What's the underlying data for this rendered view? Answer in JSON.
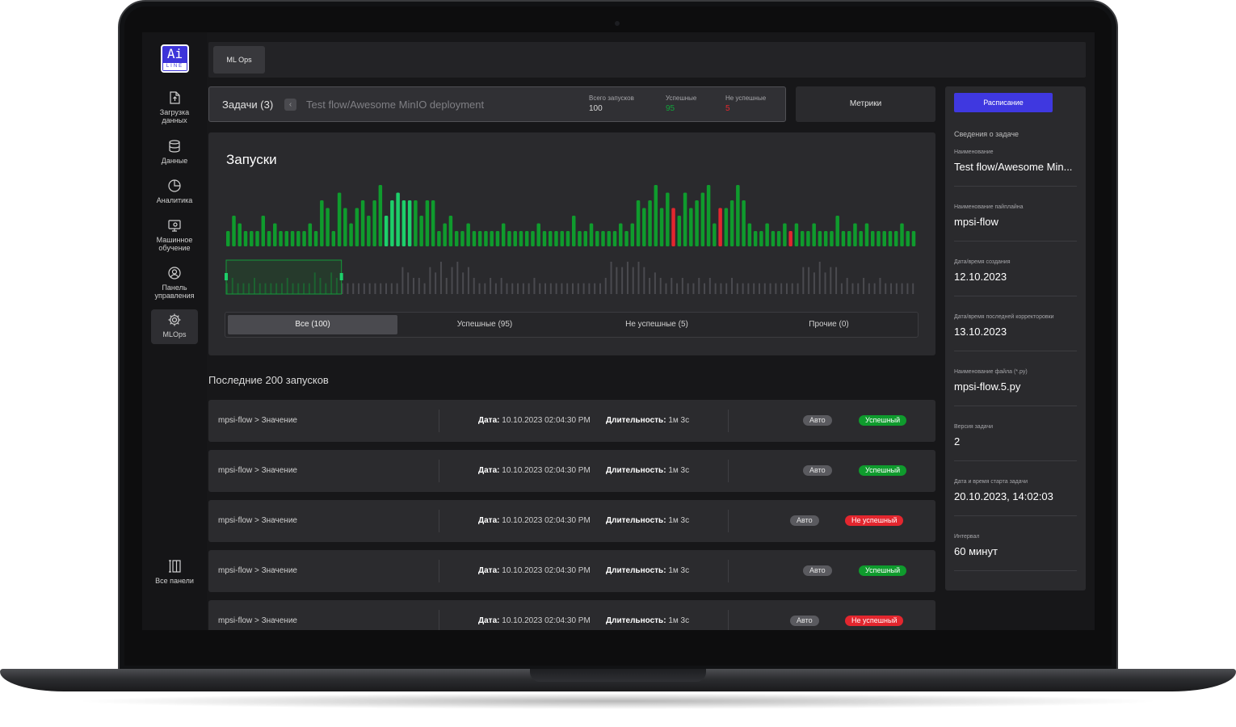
{
  "app": {
    "logo_text": "Ai",
    "logo_sub": "LINE"
  },
  "sidebar": {
    "items": [
      {
        "label": "Загрузка данных",
        "icon": "file-upload-icon"
      },
      {
        "label": "Данные",
        "icon": "database-icon"
      },
      {
        "label": "Аналитика",
        "icon": "pie-chart-icon"
      },
      {
        "label": "Машинное обучение",
        "icon": "monitor-gear-icon"
      },
      {
        "label": "Панель управления",
        "icon": "user-badge-icon"
      },
      {
        "label": "MLOps",
        "icon": "gear-icon",
        "active": true
      }
    ],
    "all_panels": {
      "label": "Все панели",
      "icon": "panels-icon"
    }
  },
  "topbar": {
    "tab_label": "ML Ops"
  },
  "task": {
    "title": "Задачи (3)",
    "back_icon": "chevron-left-icon",
    "path": "Test flow/Awesome MinIO deployment",
    "stats": [
      {
        "label": "Всего запусков",
        "value": "100",
        "color": "#d8d8d8"
      },
      {
        "label": "Успешные",
        "value": "95",
        "color": "#12a33a"
      },
      {
        "label": "Не успешные",
        "value": "5",
        "color": "#e3262e"
      }
    ]
  },
  "metrics_button": "Метрики",
  "runs_chart": {
    "title": "Запуски",
    "filters": [
      "Все (100)",
      "Успешные (95)",
      "Не успешные (5)",
      "Прочие (0)"
    ],
    "active_filter": 0
  },
  "chart_data": {
    "type": "bar",
    "title": "Запуски",
    "colors": {
      "success": "#0f9b2d",
      "success_highlight": "#1dcf6a",
      "fail": "#e3262e",
      "overview": "#4a4a4f"
    },
    "highlighted_range": [
      27,
      31
    ],
    "values": [
      2,
      4,
      3,
      2,
      2,
      2,
      4,
      2,
      3,
      2,
      2,
      2,
      2,
      2,
      3,
      2,
      6,
      5,
      2,
      7,
      5,
      3,
      5,
      6,
      4,
      6,
      8,
      4,
      6,
      7,
      6,
      6,
      6,
      4,
      6,
      6,
      2,
      3,
      4,
      2,
      2,
      3,
      2,
      2,
      2,
      2,
      2,
      3,
      2,
      2,
      2,
      2,
      2,
      3,
      2,
      2,
      2,
      2,
      2,
      4,
      2,
      2,
      3,
      2,
      2,
      2,
      2,
      3,
      2,
      3,
      6,
      5,
      6,
      8,
      5,
      7,
      5,
      4,
      7,
      5,
      6,
      7,
      8,
      3,
      5,
      5,
      6,
      8,
      6,
      3,
      2,
      2,
      3,
      2,
      2,
      3,
      2,
      3,
      2,
      2,
      3,
      2,
      2,
      2,
      4,
      2,
      2,
      3,
      2,
      3,
      2,
      2,
      2,
      2,
      2,
      3,
      2,
      2
    ],
    "fail_indices": [
      76,
      84,
      96
    ],
    "ylim": [
      0,
      8
    ],
    "overview_values": [
      2,
      3,
      2,
      2,
      2,
      3,
      2,
      2,
      2,
      2,
      2,
      3,
      2,
      2,
      2,
      2,
      4,
      3,
      2,
      4,
      3,
      2,
      2,
      2,
      2,
      2,
      2,
      2,
      2,
      2,
      2,
      2,
      5,
      4,
      3,
      3,
      2,
      5,
      4,
      6,
      3,
      5,
      6,
      4,
      5,
      3,
      2,
      2,
      3,
      2,
      3,
      2,
      2,
      2,
      2,
      2,
      3,
      2,
      2,
      2,
      2,
      2,
      2,
      2,
      2,
      2,
      2,
      2,
      2,
      3,
      6,
      5,
      5,
      6,
      5,
      6,
      5,
      3,
      4,
      3,
      2,
      3,
      2,
      3,
      2,
      2,
      3,
      2,
      3,
      2,
      2,
      2,
      3,
      2,
      2,
      2,
      2,
      2,
      2,
      2,
      2,
      2,
      2,
      2,
      2,
      5,
      5,
      4,
      6,
      4,
      5,
      5,
      2,
      3,
      2,
      2,
      3,
      2,
      2,
      3,
      2,
      2,
      2,
      2,
      2,
      2
    ],
    "overview_selection": [
      0,
      20
    ]
  },
  "runs_list": {
    "title": "Последние 200 запусков",
    "date_label": "Дата:",
    "duration_label": "Длительность:",
    "rows": [
      {
        "name": "mpsi-flow > Значение",
        "date": "10.10.2023 02:04:30 PM",
        "duration": "1м 3с",
        "mode": "Авто",
        "status": "Успешный",
        "ok": true
      },
      {
        "name": "mpsi-flow > Значение",
        "date": "10.10.2023 02:04:30 PM",
        "duration": "1м 3с",
        "mode": "Авто",
        "status": "Успешный",
        "ok": true
      },
      {
        "name": "mpsi-flow > Значение",
        "date": "10.10.2023 02:04:30 PM",
        "duration": "1м 3с",
        "mode": "Авто",
        "status": "Не успешный",
        "ok": false
      },
      {
        "name": "mpsi-flow > Значение",
        "date": "10.10.2023 02:04:30 PM",
        "duration": "1м 3с",
        "mode": "Авто",
        "status": "Успешный",
        "ok": true
      },
      {
        "name": "mpsi-flow > Значение",
        "date": "10.10.2023 02:04:30 PM",
        "duration": "1м 3с",
        "mode": "Авто",
        "status": "Не успешный",
        "ok": false
      }
    ]
  },
  "right_panel": {
    "schedule_button": "Расписание",
    "heading": "Сведения о задаче",
    "fields": [
      {
        "label": "Наименование",
        "value": "Test flow/Awesome Min..."
      },
      {
        "label": "Наименование пайплайна",
        "value": "mpsi-flow"
      },
      {
        "label": "Дата/время создания",
        "value": "12.10.2023"
      },
      {
        "label": "Дата/время последней корректоровки",
        "value": "13.10.2023"
      },
      {
        "label": "Наименование файла (*.py)",
        "value": "mpsi-flow.5.py"
      },
      {
        "label": "Версия задачи",
        "value": "2"
      },
      {
        "label": "Дата и время старта задачи",
        "value": "20.10.2023, 14:02:03"
      },
      {
        "label": "Интервал",
        "value": "60 минут"
      }
    ]
  }
}
